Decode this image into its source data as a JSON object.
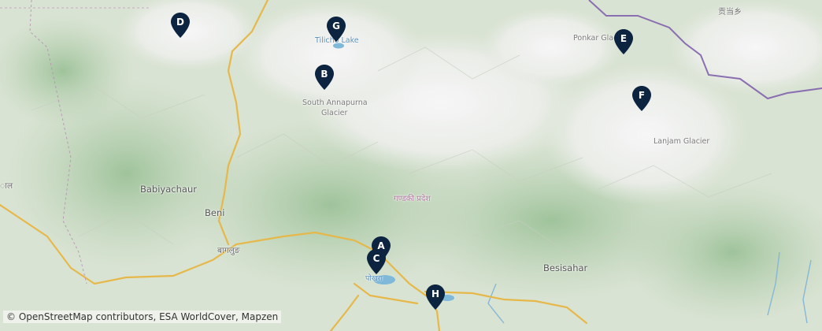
{
  "map": {
    "place_labels": [
      {
        "id": "tilicho",
        "text": "Tilicho Lake"
      },
      {
        "id": "ponkar",
        "text": "Ponkar Glacier"
      },
      {
        "id": "chinese",
        "text": "贡当乡"
      },
      {
        "id": "south-annapurna-1",
        "text": "South Annapurna"
      },
      {
        "id": "south-annapurna-2",
        "text": "Glacier"
      },
      {
        "id": "lanjam",
        "text": "Lanjam Glacier"
      },
      {
        "id": "babiyachaur",
        "text": "Babiyachaur"
      },
      {
        "id": "beni",
        "text": "Beni"
      },
      {
        "id": "baglung",
        "text": "बागलुङ"
      },
      {
        "id": "gandaki",
        "text": "गण्डकी प्रदेश"
      },
      {
        "id": "besisahar",
        "text": "Besisahar"
      },
      {
        "id": "pokhara",
        "text": "पोखरा"
      },
      {
        "id": "west-edge",
        "text": "ाल"
      }
    ],
    "markers": [
      {
        "label": "D"
      },
      {
        "label": "G"
      },
      {
        "label": "B"
      },
      {
        "label": "E"
      },
      {
        "label": "F"
      },
      {
        "label": "A"
      },
      {
        "label": "C"
      },
      {
        "label": "H"
      }
    ],
    "attribution": "© OpenStreetMap contributors, ESA WorldCover, Mapzen",
    "colors": {
      "marker": "#0d2440",
      "forest": "#a9c9a4",
      "snow": "#f3f4f6",
      "road": "#e6b84a",
      "border": "#8a6fb0",
      "water": "#7fb8d8"
    }
  }
}
